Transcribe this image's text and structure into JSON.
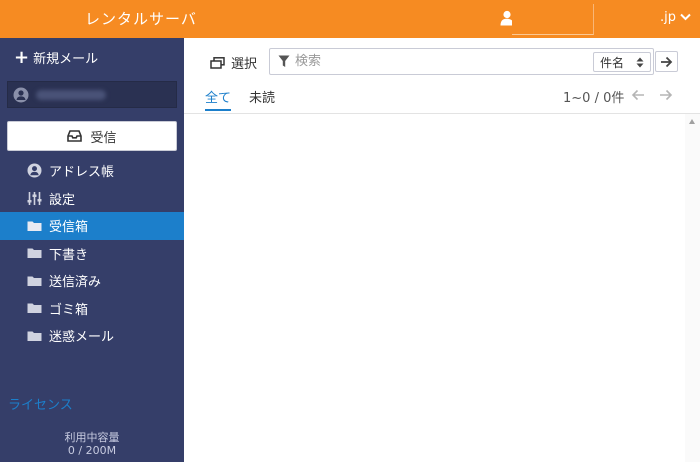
{
  "header": {
    "brand": "レンタルサーバ",
    "domain": ".jp"
  },
  "sidebar": {
    "compose_label": "新規メール",
    "receive_label": "受信",
    "items": [
      {
        "label": "アドレス帳",
        "icon": "address-book-icon"
      },
      {
        "label": "設定",
        "icon": "settings-sliders-icon"
      },
      {
        "label": "受信箱",
        "icon": "folder-icon",
        "active": true
      },
      {
        "label": "下書き",
        "icon": "folder-icon"
      },
      {
        "label": "送信済み",
        "icon": "folder-icon"
      },
      {
        "label": "ゴミ箱",
        "icon": "folder-icon"
      },
      {
        "label": "迷惑メール",
        "icon": "folder-icon"
      }
    ],
    "license_label": "ライセンス",
    "usage_label": "利用中容量",
    "usage_value": "0 / 200M"
  },
  "toolbar": {
    "select_label": "選択",
    "search_placeholder": "検索",
    "sort_value": "件名"
  },
  "tabs": [
    {
      "label": "全て",
      "active": true
    },
    {
      "label": "未読",
      "active": false
    }
  ],
  "pager": {
    "text": "1~0 / 0件"
  },
  "colors": {
    "header": "#f68b22",
    "sidebar": "#353e69",
    "accent": "#1c7fcb"
  }
}
